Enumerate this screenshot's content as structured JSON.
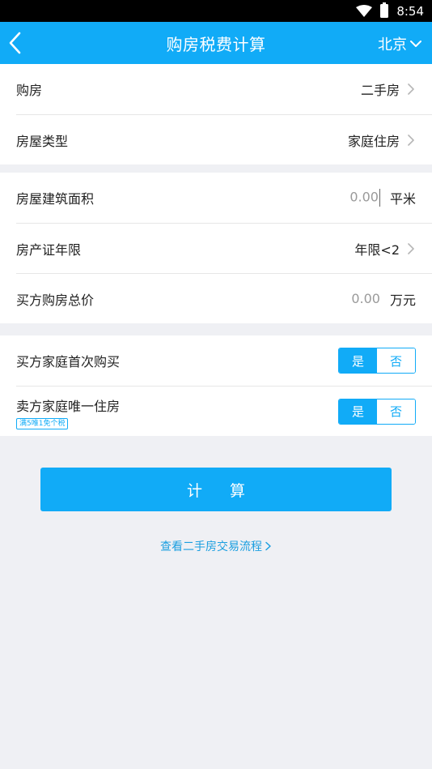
{
  "status": {
    "time": "8:54"
  },
  "navbar": {
    "title": "购房税费计算",
    "city": "北京"
  },
  "group1": {
    "purchase": {
      "label": "购房",
      "value": "二手房"
    },
    "house_type": {
      "label": "房屋类型",
      "value": "家庭住房"
    }
  },
  "group2": {
    "area": {
      "label": "房屋建筑面积",
      "value": "0.00",
      "unit": "平米"
    },
    "cert_years": {
      "label": "房产证年限",
      "value": "年限<2"
    },
    "total_price": {
      "label": "买方购房总价",
      "value": "0.00",
      "unit": "万元"
    }
  },
  "group3": {
    "first_purchase": {
      "label": "买方家庭首次购买",
      "yes": "是",
      "no": "否"
    },
    "only_house": {
      "label": "卖方家庭唯一住房",
      "tag": "满5唯1免个税",
      "yes": "是",
      "no": "否"
    }
  },
  "actions": {
    "calculate": "计 算",
    "flow_link": "查看二手房交易流程"
  },
  "colors": {
    "accent": "#11abf7",
    "background": "#eff0f4"
  }
}
